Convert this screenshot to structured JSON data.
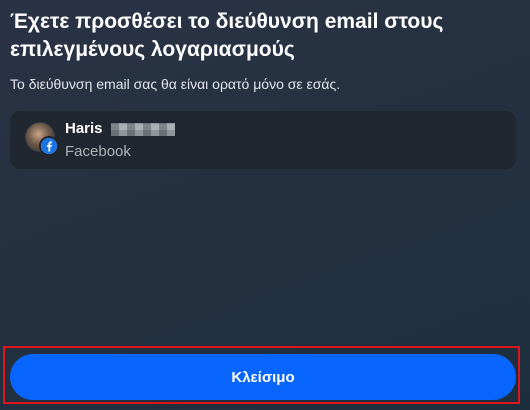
{
  "dialog": {
    "title": "Έχετε προσθέσει το διεύθυνση email στους επιλεγμένους λογαριασμούς",
    "subtitle": "Το διεύθυνση email σας θα είναι ορατό μόνο σε εσάς."
  },
  "account": {
    "name": "Haris",
    "platform": "Facebook",
    "platform_icon": "facebook-icon",
    "avatar": "user-avatar"
  },
  "actions": {
    "close_label": "Κλείσιμο"
  },
  "colors": {
    "accent": "#0866ff",
    "highlight": "#e0141e",
    "card_background": "#20262e"
  }
}
